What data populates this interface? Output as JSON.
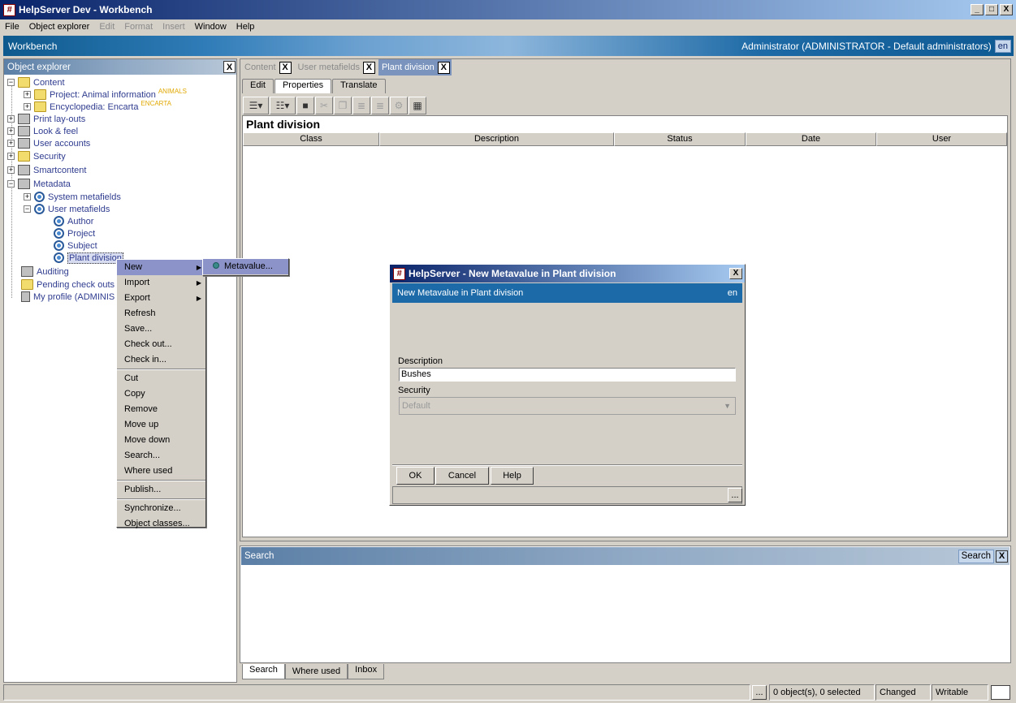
{
  "window": {
    "title": "HelpServer Dev - Workbench",
    "app_icon": "#",
    "min": "_",
    "max": "□",
    "close": "X"
  },
  "menu": [
    "File",
    "Object explorer",
    "Edit",
    "Format",
    "Insert",
    "Window",
    "Help"
  ],
  "workbench": {
    "label": "Workbench",
    "user": "Administrator (ADMINISTRATOR - Default administrators)",
    "lang": "en"
  },
  "explorer": {
    "title": "Object explorer",
    "close": "X",
    "content": "Content",
    "project": "Project: Animal information",
    "project_tag": "ANIMALS",
    "encyclopedia": "Encyclopedia: Encarta",
    "encyclopedia_tag": "ENCARTA",
    "print": "Print lay-outs",
    "look": "Look & feel",
    "users": "User accounts",
    "security": "Security",
    "smartcontent": "Smartcontent",
    "metadata": "Metadata",
    "system_mf": "System metafields",
    "user_mf": "User metafields",
    "author": "Author",
    "projectmf": "Project",
    "subject": "Subject",
    "plant": "Plant division",
    "auditing": "Auditing",
    "pending": "Pending check outs",
    "profile": "My profile (ADMINIS"
  },
  "tabs": [
    {
      "label": "Content",
      "close": "X"
    },
    {
      "label": "User metafields",
      "close": "X"
    },
    {
      "label": "Plant division",
      "close": "X"
    }
  ],
  "subtabs": [
    "Edit",
    "Properties",
    "Translate"
  ],
  "grid": {
    "title": "Plant division",
    "columns": [
      "Class",
      "Description",
      "Status",
      "Date",
      "User"
    ]
  },
  "context_menu": {
    "new": "New",
    "import": "Import",
    "export": "Export",
    "refresh": "Refresh",
    "save": "Save...",
    "checkout": "Check out...",
    "checkin": "Check in...",
    "cut": "Cut",
    "copy": "Copy",
    "remove": "Remove",
    "moveup": "Move up",
    "movedown": "Move down",
    "search": "Search...",
    "whereused": "Where used",
    "publish": "Publish...",
    "sync": "Synchronize...",
    "classes": "Object classes...",
    "sub_metavalue": "Metavalue..."
  },
  "dialog": {
    "title": "HelpServer - New Metavalue in Plant division",
    "close": "X",
    "header": "New Metavalue in Plant division",
    "lang": "en",
    "desc_label": "Description",
    "desc_value": "Bushes",
    "sec_label": "Security",
    "sec_value": "Default",
    "ok": "OK",
    "cancel": "Cancel",
    "help": "Help",
    "more": "..."
  },
  "search_panel": {
    "title": "Search",
    "button": "Search",
    "close": "X"
  },
  "bottom_tabs": [
    "Search",
    "Where used",
    "Inbox"
  ],
  "status": {
    "more": "...",
    "objects": "0 object(s), 0 selected",
    "changed": "Changed",
    "writable": "Writable"
  }
}
